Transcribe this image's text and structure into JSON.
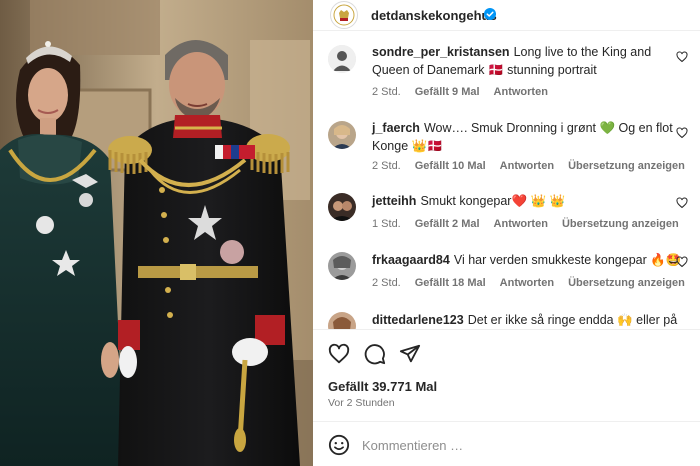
{
  "post": {
    "username": "detdanskekongehus",
    "likes_text": "Gefällt 39.771 Mal",
    "time_text": "Vor 2 Stunden"
  },
  "comments": [
    {
      "user": "sondre_per_kristansen",
      "text": "Long live to the King and Queen of Danemark 🇩🇰 stunning portrait",
      "time": "2 Std.",
      "likes": "Gefällt 9 Mal",
      "reply": "Antworten",
      "translate": ""
    },
    {
      "user": "j_faerch",
      "text": "Wow…. Smuk Dronning i grønt 💚 Og en flot Konge 👑🇩🇰",
      "time": "2 Std.",
      "likes": "Gefällt 10 Mal",
      "reply": "Antworten",
      "translate": "Übersetzung anzeigen"
    },
    {
      "user": "jetteihh",
      "text": "Smukt kongepar❤️ 👑 👑",
      "time": "1 Std.",
      "likes": "Gefällt 2 Mal",
      "reply": "Antworten",
      "translate": "Übersetzung anzeigen"
    },
    {
      "user": "frkaagaard84",
      "text": "Vi har verden smukkeste kongepar 🔥🤩",
      "time": "2 Std.",
      "likes": "Gefällt 18 Mal",
      "reply": "Antworten",
      "translate": "Übersetzung anzeigen"
    },
    {
      "user": "dittedarlene123",
      "text": "Det er ikke så ringe endda 🙌 eller på",
      "time": "",
      "likes": "",
      "reply": "",
      "translate": ""
    }
  ],
  "add_comment": {
    "placeholder": "Kommentieren …"
  },
  "icons": {
    "like": "heart-icon",
    "comment": "comment-icon",
    "share": "send-icon",
    "emoji": "emoji-icon",
    "verified": "verified-badge-icon"
  },
  "colors": {
    "verified": "#0095f6",
    "meta_text": "#737373",
    "text": "#262626"
  }
}
